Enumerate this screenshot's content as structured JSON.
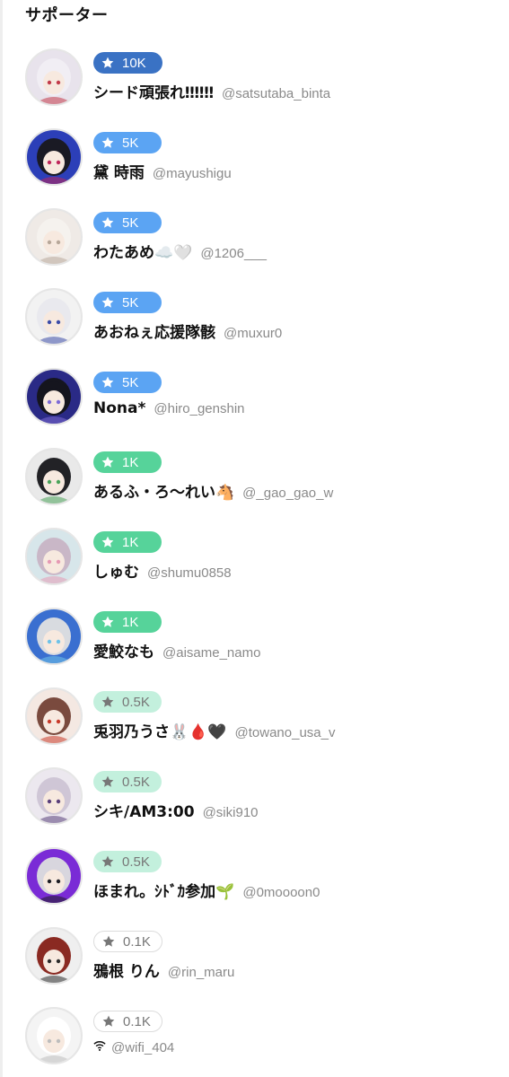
{
  "section": {
    "title": "サポーター"
  },
  "supporters": [
    {
      "tier": "10K",
      "tier_class": "tier-10k",
      "name": "シード頑張れ‼︎‼︎‼︎",
      "handle": "@satsutaba_binta",
      "avatar_bg": "#e8e3ec",
      "avatar_hair": "#f1eef4",
      "avatar_accent": "#c23b4a"
    },
    {
      "tier": "5K",
      "tier_class": "tier-5k",
      "name": "黛 時雨",
      "handle": "@mayushigu",
      "avatar_bg": "#2c3fb8",
      "avatar_hair": "#1a1a24",
      "avatar_accent": "#c0265a"
    },
    {
      "tier": "5K",
      "tier_class": "tier-5k",
      "name": "わたあめ☁️🤍",
      "handle": "@1206___",
      "avatar_bg": "#efeae6",
      "avatar_hair": "#f5f2ee",
      "avatar_accent": "#b8a89a"
    },
    {
      "tier": "5K",
      "tier_class": "tier-5k",
      "name": "あおねぇ応援隊骸",
      "handle": "@muxur0",
      "avatar_bg": "#f2f2f2",
      "avatar_hair": "#e9e9ee",
      "avatar_accent": "#3c4ca8"
    },
    {
      "tier": "5K",
      "tier_class": "tier-5k",
      "name": "Nona*",
      "handle": "@hiro_genshin",
      "avatar_bg": "#2a2a86",
      "avatar_hair": "#15151e",
      "avatar_accent": "#7d6bd6"
    },
    {
      "tier": "1K",
      "tier_class": "tier-1k",
      "name": "あるふ・ろ〜れい🐴",
      "handle": "@_gao_gao_w",
      "avatar_bg": "#e9e9e9",
      "avatar_hair": "#222226",
      "avatar_accent": "#4aa35a"
    },
    {
      "tier": "1K",
      "tier_class": "tier-1k",
      "name": "しゅむ",
      "handle": "@shumu0858",
      "avatar_bg": "#d7e6ea",
      "avatar_hair": "#c9b7c7",
      "avatar_accent": "#e69ab4"
    },
    {
      "tier": "1K",
      "tier_class": "tier-1k",
      "name": "愛鮫なも",
      "handle": "@aisame_namo",
      "avatar_bg": "#3a6fd0",
      "avatar_hair": "#d8dbe0",
      "avatar_accent": "#6fc2e8"
    },
    {
      "tier": "0.5K",
      "tier_class": "tier-05k",
      "name": "兎羽乃うさ🐰🩸🖤",
      "handle": "@towano_usa_v",
      "avatar_bg": "#f4e8e2",
      "avatar_hair": "#7a4a3e",
      "avatar_accent": "#c83a2a"
    },
    {
      "tier": "0.5K",
      "tier_class": "tier-05k",
      "name": "シキ/AM3:00",
      "handle": "@siki910",
      "avatar_bg": "#ece8ef",
      "avatar_hair": "#cfc6d6",
      "avatar_accent": "#5a3f7a"
    },
    {
      "tier": "0.5K",
      "tier_class": "tier-05k",
      "name": "ほまれ。ｼﾄﾞｶ参加🌱",
      "handle": "@0moooon0",
      "avatar_bg": "#7a2bd6",
      "avatar_hair": "#d8d6de",
      "avatar_accent": "#1e1e24"
    },
    {
      "tier": "0.1K",
      "tier_class": "tier-01k",
      "name": "鴉根 りん",
      "handle": "@rin_maru",
      "avatar_bg": "#efefef",
      "avatar_hair": "#8a2a22",
      "avatar_accent": "#2a2a2a"
    },
    {
      "tier": "0.1K",
      "tier_class": "tier-01k",
      "name": "",
      "handle": "@wifi_404",
      "avatar_bg": "#f4f4f4",
      "avatar_hair": "#ffffff",
      "avatar_accent": "#bdbdbd",
      "name_icon": "wifi-icon"
    }
  ]
}
